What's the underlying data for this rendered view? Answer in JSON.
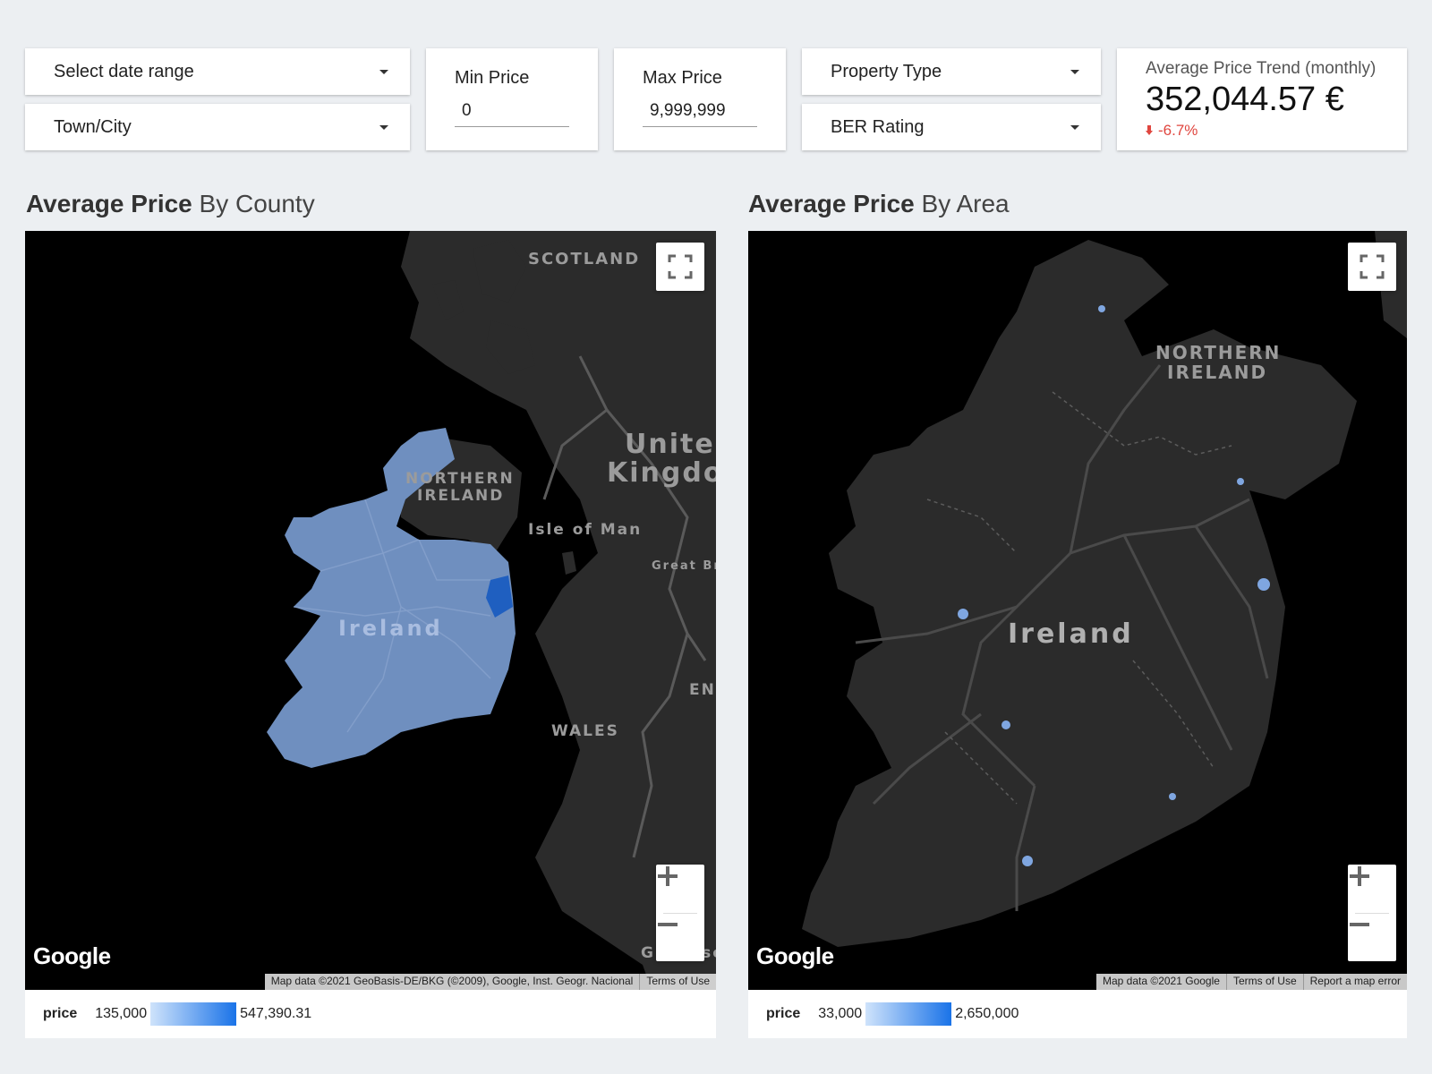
{
  "filters": {
    "date_range": "Select date range",
    "town_city": "Town/City",
    "property_type": "Property Type",
    "ber_rating": "BER Rating",
    "min_price_label": "Min Price",
    "min_price_value": "0",
    "max_price_label": "Max Price",
    "max_price_value": "9,999,999"
  },
  "trend": {
    "title": "Average Price Trend (monthly)",
    "value": "352,044.57 €",
    "change": "-6.7%",
    "change_color": "#e0463f"
  },
  "county_map": {
    "title_bold": "Average Price",
    "title_light": "By County",
    "labels": {
      "scotland": "SCOTLAND",
      "ni_line1": "NORTHERN",
      "ni_line2": "IRELAND",
      "uk_line1": "United",
      "uk_line2": "Kingdo",
      "isle_of_man": "Isle of Man",
      "great_britain": "Great Brita",
      "ireland": "Ireland",
      "wales": "WALES",
      "en": "EN",
      "guernsey": "Guernsey"
    },
    "google": "Google",
    "attribution": [
      "Map data ©2021 GeoBasis-DE/BKG (©2009), Google, Inst. Geogr. Nacional",
      "Terms of Use"
    ],
    "legend": {
      "label": "price",
      "min": "135,000",
      "max": "547,390.31"
    }
  },
  "area_map": {
    "title_bold": "Average Price",
    "title_light": "By Area",
    "labels": {
      "ni_line1": "NORTHERN",
      "ni_line2": "IRELAND",
      "ireland": "Ireland"
    },
    "google": "Google",
    "attribution": [
      "Map data ©2021 Google",
      "Terms of Use",
      "Report a map error"
    ],
    "legend": {
      "label": "price",
      "min": "33,000",
      "max": "2,650,000"
    }
  },
  "icons": {
    "fullscreen": "fullscreen-icon",
    "zoom_in": "plus-icon",
    "zoom_out": "minus-icon",
    "trend_down": "arrow-down-icon"
  },
  "colors": {
    "accent_blue": "#1a73e8",
    "map_bg": "#000000",
    "land": "#2b2b2b",
    "county_fill": "#6f8fbf"
  }
}
